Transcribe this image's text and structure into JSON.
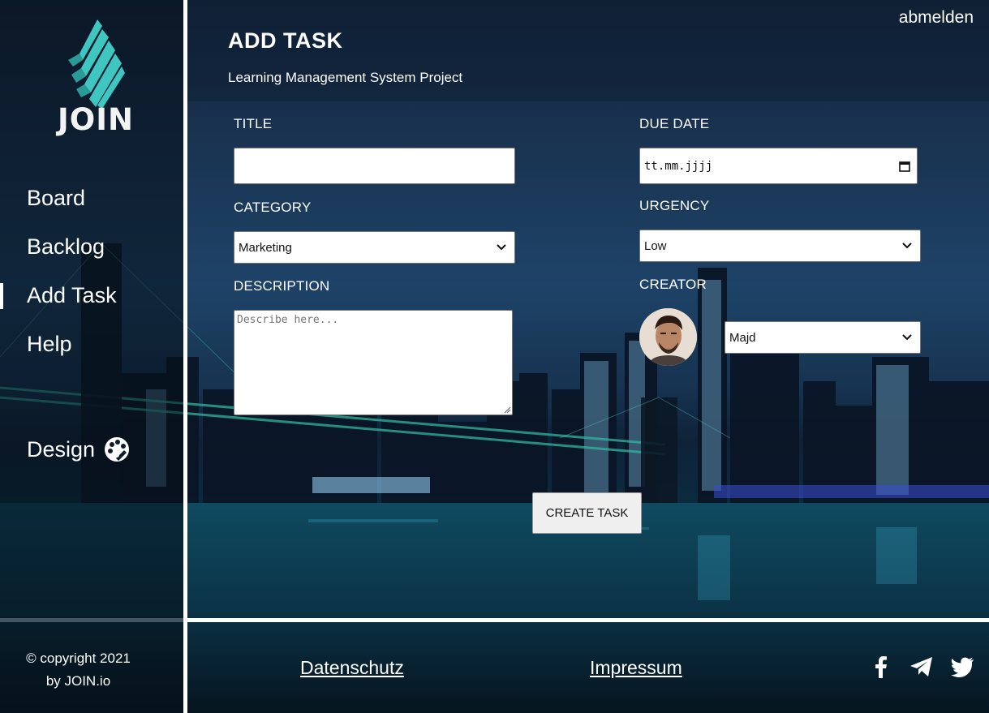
{
  "app": {
    "logo_text": "JOIN"
  },
  "sidebar": {
    "items": [
      {
        "label": "Board"
      },
      {
        "label": "Backlog"
      },
      {
        "label": "Add Task",
        "active": true
      },
      {
        "label": "Help"
      }
    ],
    "design_label": "Design",
    "copyright_line1": "© copyright 2021",
    "copyright_line2": "by JOIN.io"
  },
  "header": {
    "title": "ADD TASK",
    "subtitle": "Learning Management System Project",
    "logout_label": "abmelden"
  },
  "form": {
    "title_label": "TITLE",
    "title_value": "",
    "due_date_label": "DUE DATE",
    "due_date_placeholder": "tt.mm.jjjj",
    "category_label": "CATEGORY",
    "category_value": "Marketing",
    "urgency_label": "URGENCY",
    "urgency_value": "Low",
    "description_label": "DESCRIPTION",
    "description_placeholder": "Describe here...",
    "creator_label": "CREATOR",
    "creator_value": "Majd",
    "submit_label": "CREATE TASK"
  },
  "footer": {
    "privacy_label": "Datenschutz",
    "imprint_label": "Impressum",
    "social_icons": [
      "facebook-icon",
      "telegram-icon",
      "twitter-icon"
    ]
  },
  "colors": {
    "logo_teal": "#3fc6c0",
    "divider": "#ffffff",
    "background_dark": "#0d1b2e"
  }
}
